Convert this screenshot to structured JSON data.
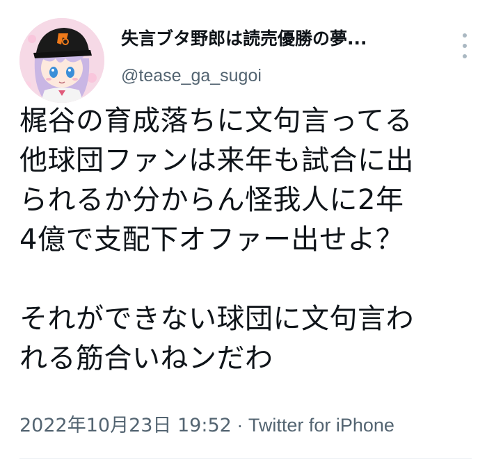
{
  "tweet": {
    "display_name": "失言ブタ野郎は読売優勝の夢...",
    "handle": "@tease_ga_sugoi",
    "text": "梶谷の育成落ちに文句言ってる\n他球団ファンは来年も試合に出\nられるか分からん怪我人に2年\n4億で支配下オファー出せよ？\n\nそれができない球団に文句言わ\nれる筋合いねンだわ",
    "timestamp": "2022年10月23日 19:52",
    "separator": " · ",
    "source": "Twitter for iPhone"
  },
  "icons": {
    "more": "more-vertical-icon",
    "avatar": "anime-avatar"
  },
  "colors": {
    "text": "#0f1419",
    "secondary": "#536471",
    "avatar_bg": "#f6d9e6",
    "cap": "#1a1a1a",
    "cap_logo": "#f07a1a"
  }
}
